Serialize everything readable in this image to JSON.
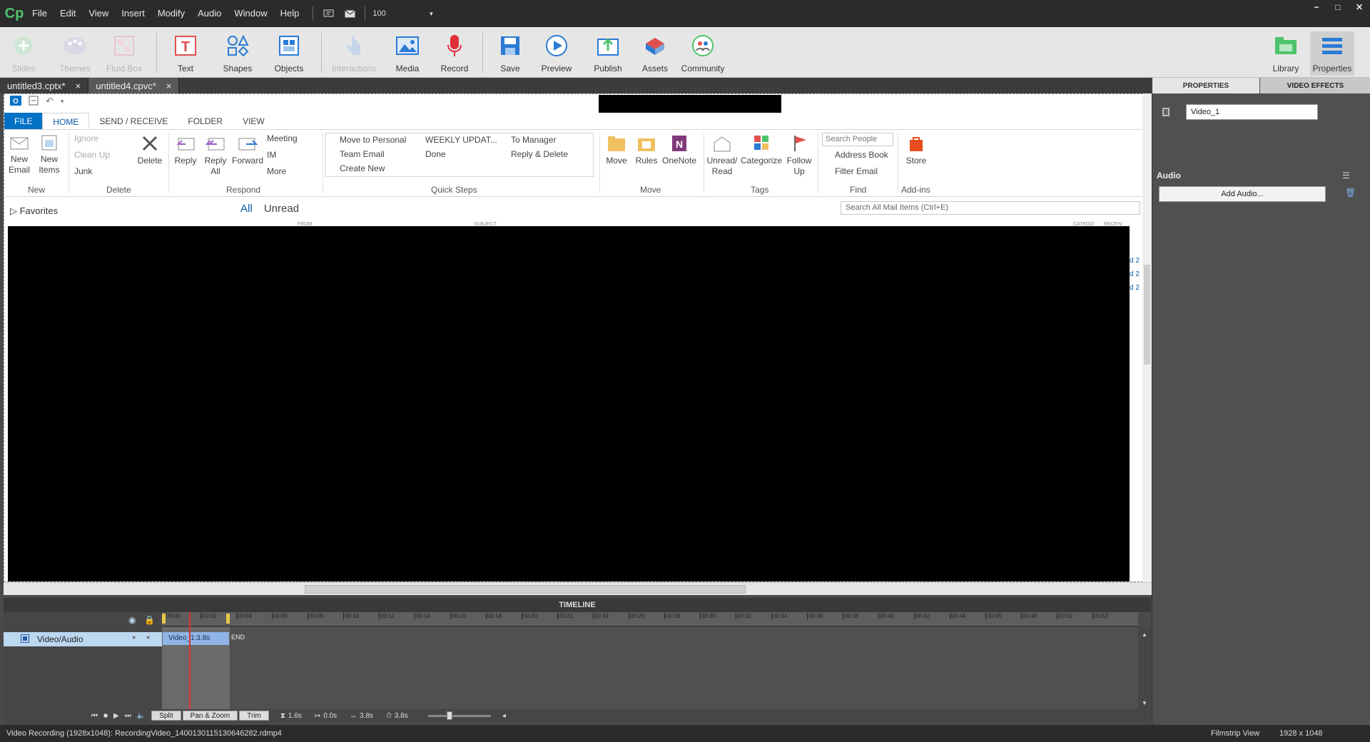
{
  "app": {
    "logo": "Cp"
  },
  "menu": [
    "File",
    "Edit",
    "View",
    "Insert",
    "Modify",
    "Audio",
    "Window",
    "Help"
  ],
  "zoom": "100",
  "window_controls": {
    "minimize": "−",
    "maximize": "□",
    "close": "✕"
  },
  "toolbar": {
    "slides": "Slides",
    "themes": "Themes",
    "fluid_box": "Fluid Box",
    "text": "Text",
    "shapes": "Shapes",
    "objects": "Objects",
    "interactions": "Interactions",
    "media": "Media",
    "record": "Record",
    "save": "Save",
    "preview": "Preview",
    "publish": "Publish",
    "assets": "Assets",
    "community": "Community",
    "library": "Library",
    "properties": "Properties"
  },
  "doc_tabs": [
    {
      "label": "untitled3.cptx*"
    },
    {
      "label": "untitled4.cpvc*"
    }
  ],
  "close_glyph": "×",
  "outlook": {
    "tabs": [
      "FILE",
      "HOME",
      "SEND / RECEIVE",
      "FOLDER",
      "VIEW"
    ],
    "ribbon": {
      "new_email": "New\nEmail",
      "new_items": "New\nItems",
      "ignore": "Ignore",
      "clean_up": "Clean Up",
      "junk": "Junk",
      "delete": "Delete",
      "reply": "Reply",
      "reply_all": "Reply\nAll",
      "forward": "Forward",
      "meeting": "Meeting",
      "im": "IM",
      "more": "More",
      "move_to_personal": "Move to Personal",
      "team_email": "Team Email",
      "create_new": "Create New",
      "weekly_update": "WEEKLY UPDAT...",
      "done": "Done",
      "to_manager": "To Manager",
      "reply_delete": "Reply & Delete",
      "move": "Move",
      "rules": "Rules",
      "onenote": "OneNote",
      "unread_read": "Unread/\nRead",
      "categorize": "Categorize",
      "follow_up": "Follow\nUp",
      "search_people": "Search People",
      "address_book": "Address Book",
      "filter_email": "Filter Email",
      "store": "Store"
    },
    "groups": [
      "New",
      "Delete",
      "Respond",
      "Quick Steps",
      "Move",
      "Tags",
      "Find",
      "Add-ins"
    ],
    "favorites": "Favorites",
    "all": "All",
    "unread": "Unread",
    "search_placeholder": "Search All Mail Items (Ctrl+E)",
    "columns": [
      "FROM",
      "SUBJECT",
      "CATEGO",
      "RECEIV"
    ],
    "peek": [
      "d 2",
      "d 2",
      "d 2"
    ]
  },
  "timeline": {
    "title": "TIMELINE",
    "ruler": [
      "00:00",
      "00:02",
      "00:04",
      "00:06",
      "00:08",
      "00:10",
      "00:12",
      "00:14",
      "00:16",
      "00:18",
      "00:20",
      "00:22",
      "00:24",
      "00:26",
      "00:28",
      "00:30",
      "00:32",
      "00:34",
      "00:36",
      "00:38",
      "00:40",
      "00:42",
      "00:44",
      "00:46",
      "00:48",
      "00:50",
      "00:52"
    ],
    "track_label": "Video/Audio",
    "clip_label": "Video_1:3.8s",
    "end_label": "END",
    "buttons": {
      "split": "Split",
      "pan_zoom": "Pan & Zoom",
      "trim": "Trim"
    },
    "readouts": {
      "duration": "1.6s",
      "start": "0.0s",
      "length": "3.8s",
      "total": "3.8s"
    }
  },
  "right_panel": {
    "tabs": {
      "properties": "PROPERTIES",
      "video_effects": "VIDEO EFFECTS"
    },
    "name_value": "Video_1",
    "audio_label": "Audio",
    "add_audio": "Add Audio..."
  },
  "status": {
    "recording": "Video Recording (1928x1048): RecordingVideo_1400130115130646282.rdmp4",
    "view": "Filmstrip View",
    "resolution": "1928 x 1048"
  },
  "colors": {
    "accent_green": "#4fc36c",
    "outlook_blue": "#0072c6",
    "record_red": "#e0303a"
  }
}
